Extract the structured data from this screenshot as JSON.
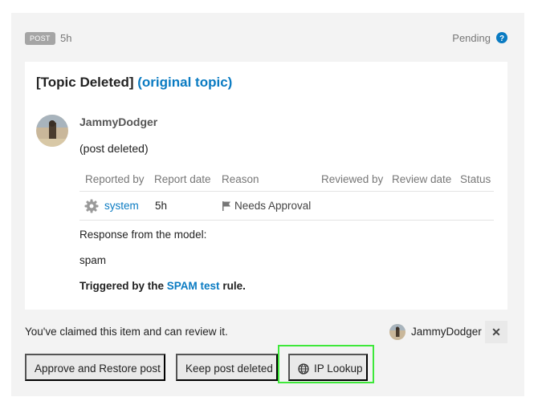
{
  "post_meta": {
    "badge": "POST",
    "age": "5h",
    "status": "Pending",
    "help_icon": "question-circle-icon"
  },
  "card": {
    "title_prefix": "[Topic Deleted]",
    "title_link": "(original topic)",
    "author": "JammyDodger",
    "post_text": "(post deleted)"
  },
  "score_table": {
    "headers": [
      "Reported by",
      "Report date",
      "Reason",
      "Reviewed by",
      "Review date",
      "Status"
    ],
    "row": {
      "reported_by": "system",
      "report_date": "5h",
      "reason": "Needs Approval",
      "icons": [
        "gear-icon",
        "flag-icon"
      ]
    }
  },
  "response": {
    "label": "Response from the model:",
    "value": "spam",
    "trigger_prefix": "Triggered by the",
    "trigger_link": "SPAM test",
    "trigger_suffix": "rule."
  },
  "claim": {
    "text": "You've claimed this item and can review it.",
    "claimer": "JammyDodger",
    "unclaim_label": "✕"
  },
  "actions": {
    "approve_label": "Approve and Restore post",
    "keep_label": "Keep post deleted",
    "ip_label": "IP Lookup",
    "ip_icon": "globe-icon"
  },
  "colors": {
    "link": "#0a7bc2",
    "panel_bg": "#f3f3f3",
    "button_bg": "#e9e9e9",
    "highlight": "#3ee83a"
  }
}
